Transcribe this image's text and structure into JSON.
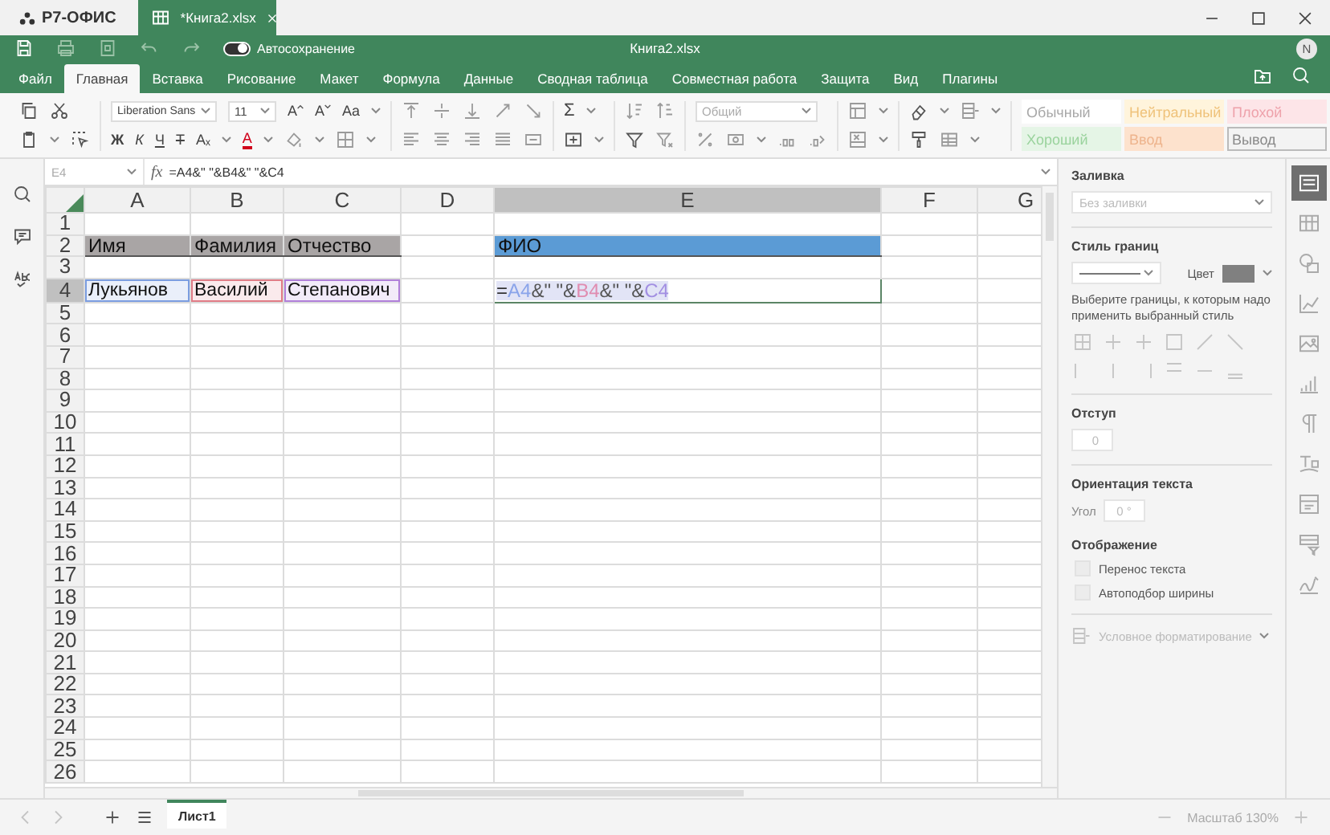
{
  "app": {
    "name": "Р7-ОФИС"
  },
  "doc_tab": {
    "title": "*Книга2.xlsx"
  },
  "quick_access": {
    "autosave": {
      "label": "Автосохранение",
      "on": true
    },
    "title": "Книга2.xlsx",
    "avatar": "N"
  },
  "menu": [
    {
      "label": "Файл",
      "selected": false
    },
    {
      "label": "Главная",
      "selected": true
    },
    {
      "label": "Вставка",
      "selected": false
    },
    {
      "label": "Рисование",
      "selected": false
    },
    {
      "label": "Макет",
      "selected": false
    },
    {
      "label": "Формула",
      "selected": false
    },
    {
      "label": "Данные",
      "selected": false
    },
    {
      "label": "Сводная таблица",
      "selected": false
    },
    {
      "label": "Совместная работа",
      "selected": false
    },
    {
      "label": "Защита",
      "selected": false
    },
    {
      "label": "Вид",
      "selected": false
    },
    {
      "label": "Плагины",
      "selected": false
    }
  ],
  "toolbar": {
    "font": "Liberation Sans",
    "size": "11",
    "grow": "A",
    "shrink": "A",
    "case": "Aa",
    "format_buttons": [
      "Ж",
      "К",
      "Ч",
      "Т",
      "Aₓ"
    ],
    "font_color": {
      "label": "A",
      "color": "#d0021b"
    },
    "sum": "Σ",
    "number_format": "Общий",
    "styles": [
      {
        "label": "Обычный",
        "kind": "normal"
      },
      {
        "label": "Нейтральный",
        "kind": "neutral"
      },
      {
        "label": "Плохой",
        "kind": "bad"
      },
      {
        "label": "Хороший",
        "kind": "good"
      },
      {
        "label": "Ввод",
        "kind": "input"
      },
      {
        "label": "Вывод",
        "kind": "output"
      }
    ]
  },
  "formula_bar": {
    "cell": "E4",
    "fx": "fx",
    "formula": "=A4&\" \"&B4&\" \"&C4"
  },
  "sheet": {
    "columns": [
      {
        "label": "A",
        "selected": false
      },
      {
        "label": "B",
        "selected": false
      },
      {
        "label": "C",
        "selected": false
      },
      {
        "label": "D",
        "selected": false
      },
      {
        "label": "E",
        "selected": true
      },
      {
        "label": "F",
        "selected": false
      },
      {
        "label": "G",
        "selected": false
      }
    ],
    "rows": [
      {
        "label": "1",
        "selected": false
      },
      {
        "label": "2",
        "selected": false,
        "cells": [
          {
            "kind": "text",
            "text": "Имя",
            "color": "#a9a5a5"
          },
          {
            "kind": "text",
            "text": "Фамилия",
            "color": "#a9a5a5"
          },
          {
            "kind": "text",
            "text": "Отчество",
            "color": "#a9a5a5"
          },
          {
            "kind": "empty"
          },
          {
            "kind": "text",
            "text": "ФИО",
            "color": "#5b9bd5"
          }
        ]
      },
      {
        "label": "3",
        "selected": false
      },
      {
        "label": "4",
        "selected": true,
        "cells": [
          {
            "kind": "ref",
            "text": "Лукьянов",
            "color": "#7b9de0"
          },
          {
            "kind": "ref",
            "text": "Василий",
            "color": "#e07c86"
          },
          {
            "kind": "ref",
            "text": "Степанович",
            "color": "#b07fd9"
          },
          {
            "kind": "empty"
          },
          {
            "kind": "formula",
            "parts": [
              {
                "text": "=",
                "color": "#333333"
              },
              {
                "text": "A4",
                "color": "#8aa4ea"
              },
              {
                "text": "&\" \"&",
                "color": "#555555"
              },
              {
                "text": "B4",
                "color": "#e08cb0"
              },
              {
                "text": "&\" \"&",
                "color": "#555555"
              },
              {
                "text": "C4",
                "color": "#a28fe2"
              }
            ]
          }
        ]
      },
      {
        "label": "5",
        "selected": false
      },
      {
        "label": "6",
        "selected": false
      },
      {
        "label": "7",
        "selected": false
      },
      {
        "label": "8",
        "selected": false
      },
      {
        "label": "9",
        "selected": false
      },
      {
        "label": "10",
        "selected": false
      },
      {
        "label": "11",
        "selected": false
      },
      {
        "label": "12",
        "selected": false
      },
      {
        "label": "13",
        "selected": false
      },
      {
        "label": "14",
        "selected": false
      },
      {
        "label": "15",
        "selected": false
      },
      {
        "label": "16",
        "selected": false
      },
      {
        "label": "17",
        "selected": false
      },
      {
        "label": "18",
        "selected": false
      },
      {
        "label": "19",
        "selected": false
      },
      {
        "label": "20",
        "selected": false
      },
      {
        "label": "21",
        "selected": false
      },
      {
        "label": "22",
        "selected": false
      },
      {
        "label": "23",
        "selected": false
      },
      {
        "label": "24",
        "selected": false
      },
      {
        "label": "25",
        "selected": false
      },
      {
        "label": "26",
        "selected": false
      }
    ]
  },
  "panel": {
    "fill": {
      "heading": "Заливка",
      "placeholder": "Без заливки"
    },
    "border": {
      "heading": "Стиль границ",
      "color_label": "Цвет",
      "color": "#808080",
      "hint": "Выберите границы, к которым надо применить выбранный стиль"
    },
    "indent": {
      "heading": "Отступ",
      "value": "0"
    },
    "orientation": {
      "heading": "Ориентация текста",
      "angle_label": "Угол",
      "value": "0 °"
    },
    "display": {
      "heading": "Отображение",
      "options": [
        {
          "label": "Перенос текста",
          "checked": false,
          "disabled": true
        },
        {
          "label": "Автоподбор ширины",
          "checked": false,
          "disabled": true
        }
      ]
    },
    "conditional": "Условное форматирование"
  },
  "panel_tabs": [
    {
      "kind": "cell",
      "selected": true
    },
    {
      "kind": "table",
      "selected": false
    },
    {
      "kind": "shape",
      "selected": false
    },
    {
      "kind": "chart",
      "selected": false
    },
    {
      "kind": "image",
      "selected": false
    },
    {
      "kind": "pivot",
      "selected": false
    },
    {
      "kind": "paragraph",
      "selected": false
    },
    {
      "kind": "textart",
      "selected": false
    },
    {
      "kind": "slicer",
      "selected": false
    },
    {
      "kind": "filter",
      "selected": false
    },
    {
      "kind": "signature",
      "selected": false
    }
  ],
  "sheets": [
    {
      "label": "Лист1",
      "selected": true
    }
  ],
  "zoom": "Масштаб 130%"
}
